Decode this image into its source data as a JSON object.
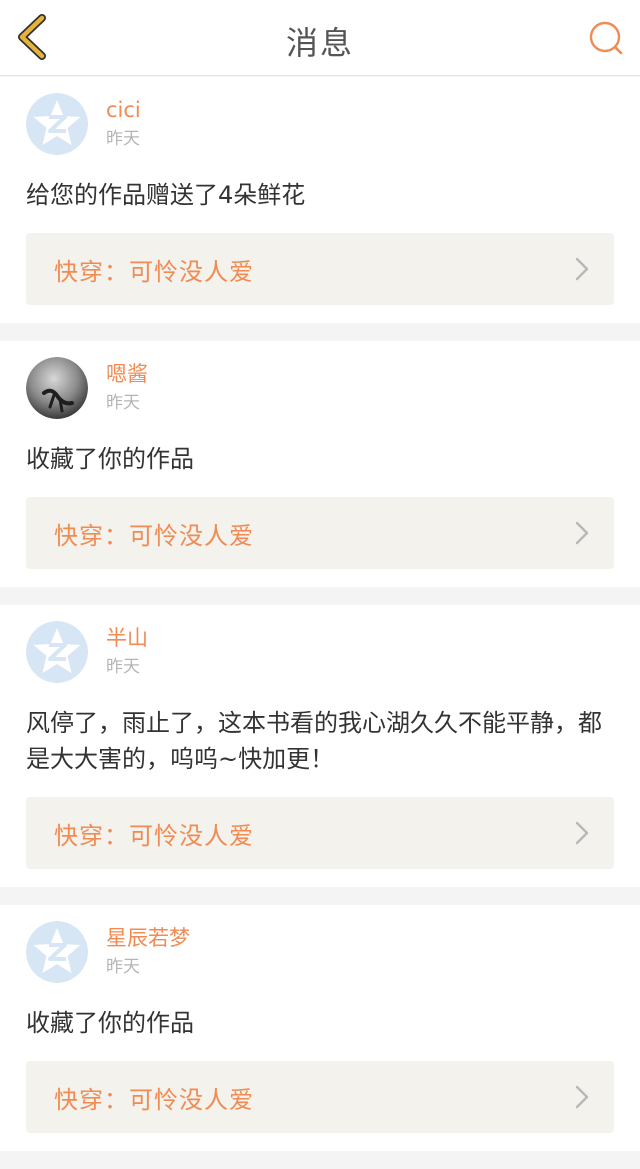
{
  "header": {
    "title": "消息"
  },
  "messages": [
    {
      "user": "cici",
      "time": "昨天",
      "avatar": "default-avatar",
      "text": "给您的作品赠送了4朵鲜花",
      "book": "快穿：可怜没人爱"
    },
    {
      "user": "嗯酱",
      "time": "昨天",
      "avatar": "photo-avatar",
      "text": "收藏了你的作品",
      "book": "快穿：可怜没人爱"
    },
    {
      "user": "半山",
      "time": "昨天",
      "avatar": "default-avatar",
      "text": "风停了，雨止了，这本书看的我心湖久久不能平静，都是大大害的，呜呜~快加更！",
      "book": "快穿：可怜没人爱"
    },
    {
      "user": "星辰若梦",
      "time": "昨天",
      "avatar": "default-avatar",
      "text": "收藏了你的作品",
      "book": "快穿：可怜没人爱"
    }
  ],
  "colors": {
    "accent": "#f08b54",
    "back_icon": "#e5b33a",
    "card_link_bg": "#f3f2ec",
    "avatar_bg": "#d6e6f4"
  }
}
